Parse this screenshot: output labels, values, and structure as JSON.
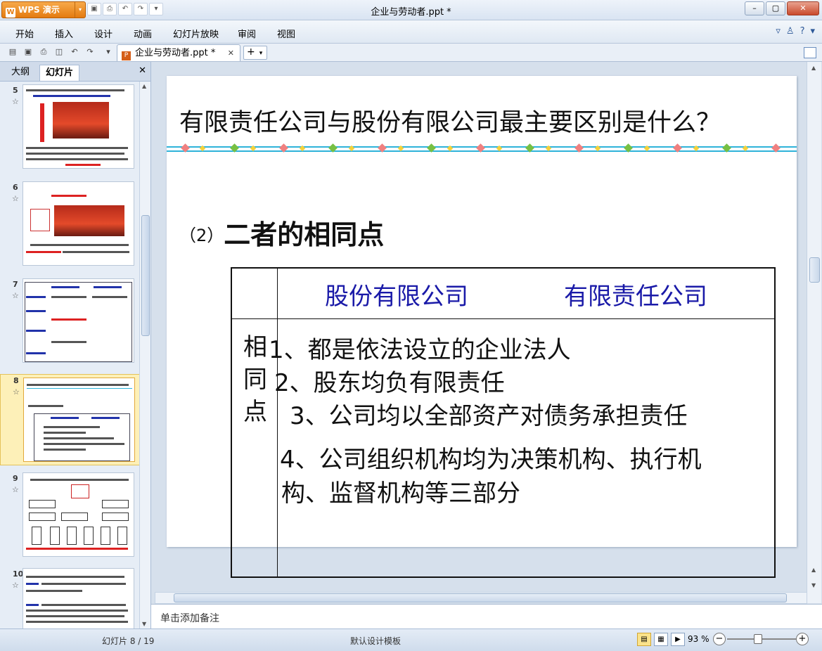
{
  "app": {
    "name": "WPS 演示",
    "window_title": "企业与劳动者.ppt *"
  },
  "menu": {
    "items": [
      "开始",
      "插入",
      "设计",
      "动画",
      "幻灯片放映",
      "审阅",
      "视图"
    ]
  },
  "document_tab": {
    "label": "企业与劳动者.ppt *",
    "close_glyph": "✕"
  },
  "left_panel": {
    "tabs": [
      "大纲",
      "幻灯片"
    ],
    "active_tab": "幻灯片",
    "slides": [
      {
        "number": "5"
      },
      {
        "number": "6"
      },
      {
        "number": "7"
      },
      {
        "number": "8"
      },
      {
        "number": "9"
      },
      {
        "number": "10"
      }
    ]
  },
  "slide": {
    "title": "有限责任公司与股份有限公司最主要区别是什么？",
    "subtitle_paren": "（2）",
    "subtitle_text": "二者的相同点",
    "table_headers": [
      "股份有限公司",
      "有限责任公司"
    ],
    "side_label": [
      "相",
      "同",
      "点"
    ],
    "points": [
      "1、都是依法设立的企业法人",
      "2、股东均负有限责任",
      "3、公司均以全部资产对债务承担责任",
      "4、公司组织机构均为决策机构、执行机",
      "构、监督机构等三部分"
    ]
  },
  "notes": {
    "placeholder": "单击添加备注"
  },
  "status": {
    "slide_counter": "幻灯片 8 / 19",
    "template": "默认设计模板",
    "zoom": "93 %"
  },
  "colors": {
    "header_blue": "#1a1aa8",
    "deco_line": "#2fb3d9",
    "app_orange": "#e47b10"
  }
}
